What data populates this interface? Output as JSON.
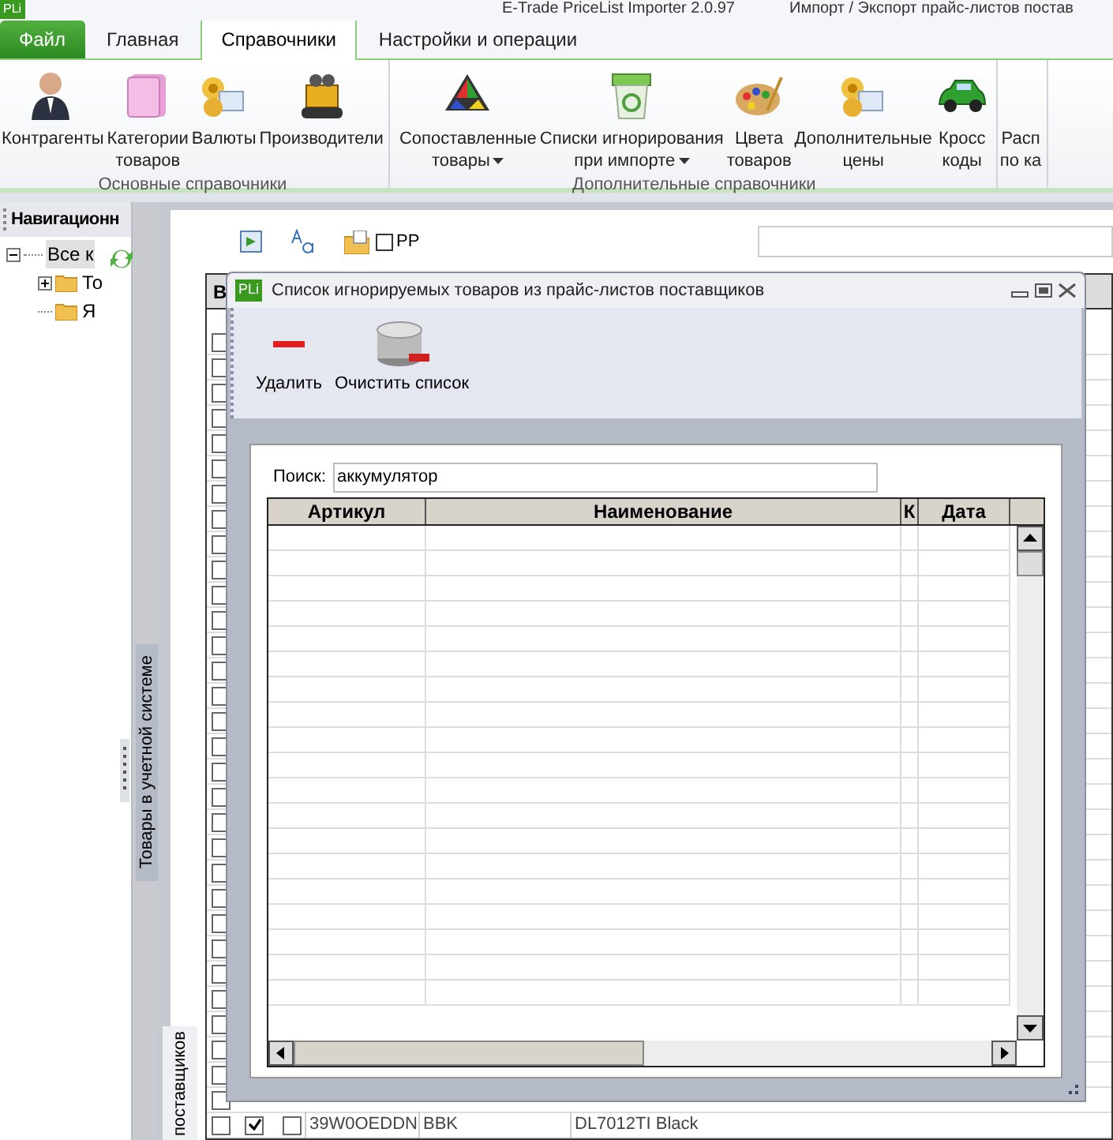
{
  "window": {
    "logo": "PLi",
    "title": "E-Trade PriceList Importer 2.0.97",
    "subtitle": "Импорт / Экспорт прайс-листов постав"
  },
  "tabs": [
    {
      "label": "Файл",
      "kind": "file",
      "selected": false
    },
    {
      "label": "Главная",
      "kind": "tab",
      "selected": false
    },
    {
      "label": "Справочники",
      "kind": "tab",
      "selected": true
    },
    {
      "label": "Настройки и операции",
      "kind": "tab",
      "selected": false
    }
  ],
  "ribbon_groups": [
    {
      "title": "Основные справочники",
      "buttons": [
        {
          "label": [
            "Контрагенты"
          ],
          "dropdown": false
        },
        {
          "label": [
            "Категории",
            "товаров"
          ],
          "dropdown": false
        },
        {
          "label": [
            "Валюты"
          ],
          "dropdown": false
        },
        {
          "label": [
            "Производители"
          ],
          "dropdown": false
        }
      ]
    },
    {
      "title": "Дополнительные справочники",
      "buttons": [
        {
          "label": [
            "Сопоставленные",
            "товары"
          ],
          "dropdown": true
        },
        {
          "label": [
            "Списки игнорирования",
            "при импорте"
          ],
          "dropdown": true
        },
        {
          "label": [
            "Цвета",
            "товаров"
          ],
          "dropdown": false
        },
        {
          "label": [
            "Дополнительные",
            "цены"
          ],
          "dropdown": false
        },
        {
          "label": [
            "Кросс",
            "коды"
          ],
          "dropdown": false
        }
      ]
    },
    {
      "buttons": [
        {
          "label": [
            "Расп",
            "по ка"
          ],
          "dropdown": false
        }
      ]
    }
  ],
  "navigation": {
    "title": "Навигационн",
    "tree": [
      {
        "label": "Все к",
        "selected": true,
        "expanded": true,
        "children": [
          {
            "label": "То",
            "expanded": false
          },
          {
            "label": "Я"
          }
        ]
      }
    ]
  },
  "side_tabs": [
    "Товары в учетной системе",
    "поставщиков"
  ],
  "main_toolbar": {
    "checkbox": {
      "label": "PP",
      "checked": false
    }
  },
  "main_grid": {
    "header": "В",
    "rows": [
      {
        "checked": false
      },
      {
        "checked": false
      },
      {
        "checked": false
      },
      {
        "checked": false
      },
      {
        "checked": false
      },
      {
        "checked": false
      },
      {
        "checked": false
      },
      {
        "checked": false
      },
      {
        "checked": false
      },
      {
        "checked": false
      },
      {
        "checked": false
      },
      {
        "checked": false
      },
      {
        "checked": false
      },
      {
        "checked": false
      },
      {
        "checked": false
      },
      {
        "checked": false
      },
      {
        "checked": false
      },
      {
        "checked": false
      },
      {
        "checked": false
      },
      {
        "checked": false
      },
      {
        "checked": false
      },
      {
        "checked": false
      },
      {
        "checked": false
      },
      {
        "checked": false
      },
      {
        "checked": false
      },
      {
        "checked": false
      },
      {
        "checked": false
      },
      {
        "checked": false
      },
      {
        "checked": false
      },
      {
        "checked": false
      },
      {
        "checked": false
      },
      {
        "checked": false,
        "flag_1": true,
        "flag_2": false,
        "column_4": "39W0OEDDN",
        "column_5": "BBK",
        "column_6": "DL7012TI Black"
      }
    ]
  },
  "dialog": {
    "logo": "PLi",
    "title": "Список игнорируемых товаров из прайс-листов поставщиков",
    "toolbar": [
      "Удалить",
      "Очистить список"
    ],
    "search": {
      "label": "Поиск:",
      "value": "аккумулятор"
    },
    "table": {
      "columns": [
        "Артикул",
        "Наименование",
        "К",
        "Дата"
      ]
    }
  }
}
